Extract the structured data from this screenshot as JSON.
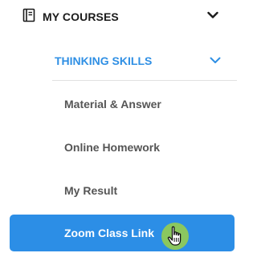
{
  "sidebar": {
    "courses": {
      "label": "MY COURSES",
      "icon": "book-icon",
      "chevron": "chevron-down-icon"
    },
    "course": {
      "label": "THINKING SKILLS",
      "chevron": "chevron-down-icon",
      "accent_color": "#2f8fe4"
    },
    "items": [
      {
        "label": "Material & Answer"
      },
      {
        "label": "Online Homework"
      },
      {
        "label": "My Result"
      },
      {
        "label": "Zoom Class Link",
        "active": true
      }
    ]
  },
  "colors": {
    "active_bg": "#2c8ee6",
    "active_text": "#ffffff",
    "item_text": "#555555",
    "header_text": "#1b1b1b",
    "cursor_halo": "#96cd50"
  },
  "cursor": {
    "icon": "hand-pointer-icon"
  }
}
